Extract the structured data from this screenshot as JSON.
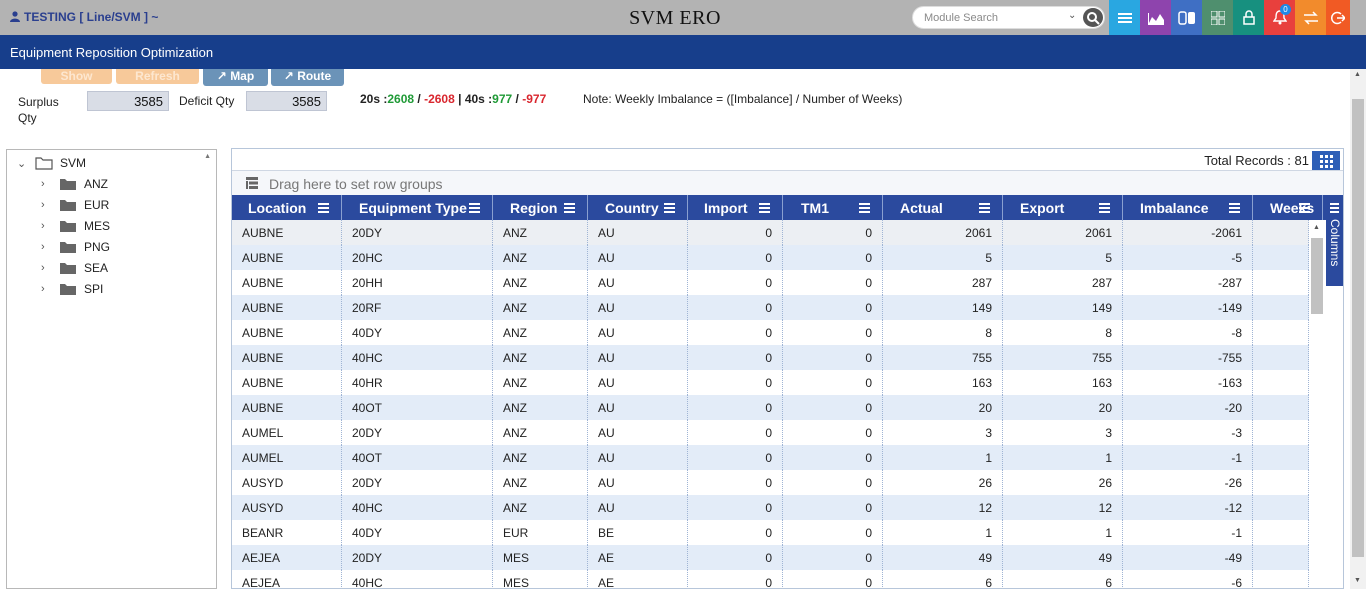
{
  "topbar": {
    "user": "TESTING [ Line/SVM ] ~",
    "title": "SVM ERO",
    "search_placeholder": "Module Search",
    "notifications_count": "0",
    "buttons": [
      {
        "name": "menu-icon",
        "color": "#29a7e1"
      },
      {
        "name": "chart-icon",
        "color": "#8e44ad"
      },
      {
        "name": "toggle-icon",
        "color": "#3f6fc4"
      },
      {
        "name": "grid-icon",
        "color": "#4f8f6e"
      },
      {
        "name": "lock-icon",
        "color": "#17907f"
      },
      {
        "name": "bell-icon",
        "color": "#e8403d"
      },
      {
        "name": "transfer-icon",
        "color": "#f28b2c"
      },
      {
        "name": "logout-icon",
        "color": "#f15a24"
      }
    ]
  },
  "page_title": "Equipment Reposition Optimization",
  "actions": {
    "show": "Show",
    "refresh": "Refresh",
    "map": "Map",
    "route": "Route"
  },
  "filters": {
    "surplus_label": "Surplus Qty",
    "surplus_value": "3585",
    "deficit_label": "Deficit Qty",
    "deficit_value": "3585"
  },
  "stats": {
    "s20_label": "20s :",
    "s20_pos": "2608",
    "s20_neg": "-2608",
    "s40_label": "40s :",
    "s40_pos": "977",
    "s40_neg": "-977",
    "note": "Note: Weekly Imbalance = ([Imbalance] / Number of Weeks)"
  },
  "tree": {
    "root": "SVM",
    "children": [
      "ANZ",
      "EUR",
      "MES",
      "PNG",
      "SEA",
      "SPI"
    ]
  },
  "grid": {
    "total_label": "Total Records :",
    "total_value": "81",
    "group_hint": "Drag here to set row groups",
    "columns_tab": "Columns",
    "headers": [
      "Location",
      "Equipment Type",
      "Region",
      "Country",
      "Import",
      "TM1",
      "Actual",
      "Export",
      "Imbalance",
      "Weeks"
    ],
    "rows": [
      [
        "AUBNE",
        "20DY",
        "ANZ",
        "AU",
        "0",
        "0",
        "2061",
        "2061",
        "-2061"
      ],
      [
        "AUBNE",
        "20HC",
        "ANZ",
        "AU",
        "0",
        "0",
        "5",
        "5",
        "-5"
      ],
      [
        "AUBNE",
        "20HH",
        "ANZ",
        "AU",
        "0",
        "0",
        "287",
        "287",
        "-287"
      ],
      [
        "AUBNE",
        "20RF",
        "ANZ",
        "AU",
        "0",
        "0",
        "149",
        "149",
        "-149"
      ],
      [
        "AUBNE",
        "40DY",
        "ANZ",
        "AU",
        "0",
        "0",
        "8",
        "8",
        "-8"
      ],
      [
        "AUBNE",
        "40HC",
        "ANZ",
        "AU",
        "0",
        "0",
        "755",
        "755",
        "-755"
      ],
      [
        "AUBNE",
        "40HR",
        "ANZ",
        "AU",
        "0",
        "0",
        "163",
        "163",
        "-163"
      ],
      [
        "AUBNE",
        "40OT",
        "ANZ",
        "AU",
        "0",
        "0",
        "20",
        "20",
        "-20"
      ],
      [
        "AUMEL",
        "20DY",
        "ANZ",
        "AU",
        "0",
        "0",
        "3",
        "3",
        "-3"
      ],
      [
        "AUMEL",
        "40OT",
        "ANZ",
        "AU",
        "0",
        "0",
        "1",
        "1",
        "-1"
      ],
      [
        "AUSYD",
        "20DY",
        "ANZ",
        "AU",
        "0",
        "0",
        "26",
        "26",
        "-26"
      ],
      [
        "AUSYD",
        "40HC",
        "ANZ",
        "AU",
        "0",
        "0",
        "12",
        "12",
        "-12"
      ],
      [
        "BEANR",
        "40DY",
        "EUR",
        "BE",
        "0",
        "0",
        "1",
        "1",
        "-1"
      ],
      [
        "AEJEA",
        "20DY",
        "MES",
        "AE",
        "0",
        "0",
        "49",
        "49",
        "-49"
      ],
      [
        "AEJEA",
        "40HC",
        "MES",
        "AE",
        "0",
        "0",
        "6",
        "6",
        "-6"
      ]
    ]
  }
}
